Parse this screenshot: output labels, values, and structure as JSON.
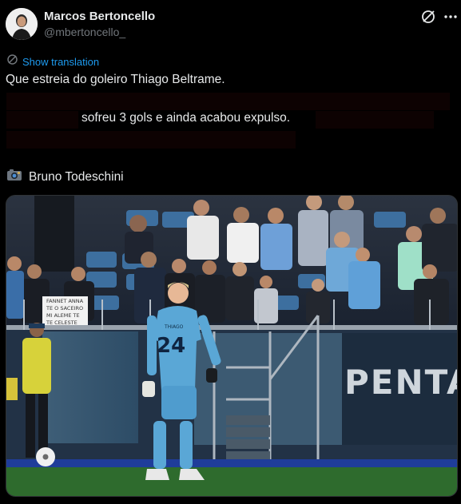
{
  "post": {
    "author_name": "Marcos Bertoncello",
    "author_handle": "@mbertoncello_",
    "translate_label": "Show translation",
    "text_line1": "Que estreia do goleiro Thiago Beltrame.",
    "text_line2": "sofreu 3 gols e ainda acabou expulso.",
    "credit_icon": "camera-emoji",
    "credit_text": "Bruno Todeschini"
  },
  "photo": {
    "jersey_name": "THIAGO",
    "jersey_number": "24",
    "banner_text": "PENTA",
    "sign_text": "FANNET ANNA\nTE O SACEIRO\nMI ALEME TE\nTE CELESTE"
  },
  "colors": {
    "background": "#000000",
    "text": "#e7e9ea",
    "muted": "#71767b",
    "accent": "#1d9bf0",
    "keeper_kit": "#5aa7d6",
    "pitch": "#2e6b2d"
  },
  "icons": {
    "grok": "grok-icon",
    "more": "more-icon",
    "translate": "translate-icon"
  }
}
